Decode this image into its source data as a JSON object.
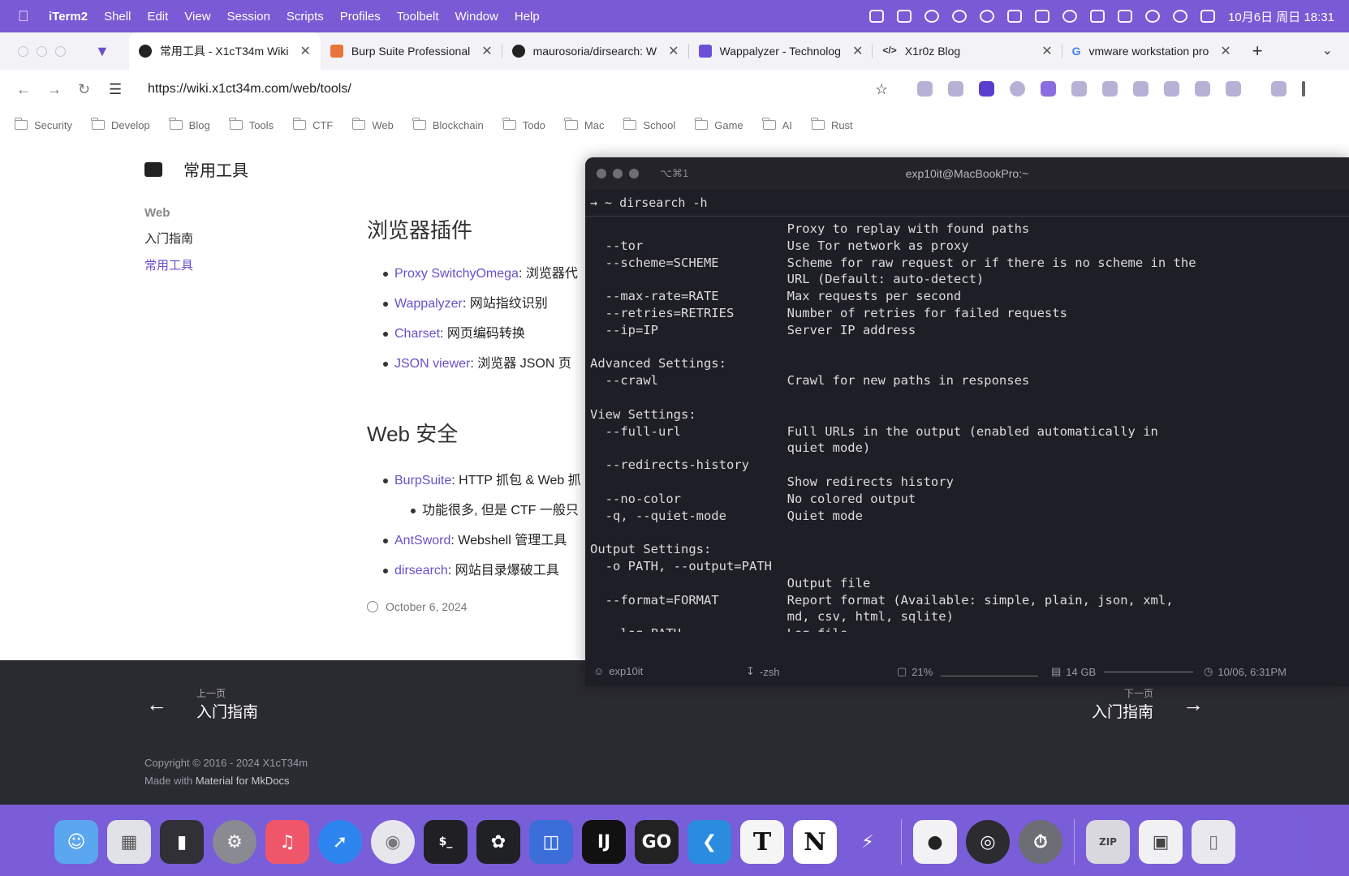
{
  "menubar": {
    "app": "iTerm2",
    "items": [
      "Shell",
      "Edit",
      "View",
      "Session",
      "Scripts",
      "Profiles",
      "Toolbelt",
      "Window",
      "Help"
    ],
    "clock": "10月6日 周日 18:31",
    "status_icons": [
      "display-icon",
      "screen-icon",
      "record-icon",
      "moon-icon",
      "vpn-icon",
      "cat-icon",
      "fan-icon",
      "sync-icon",
      "monitor-icon",
      "input-method-icon",
      "speaker-icon",
      "wifi-icon",
      "control-center-icon"
    ]
  },
  "browser": {
    "tabs": [
      {
        "title": "常用工具 - X1cT34m Wiki",
        "favicon": "#222222"
      },
      {
        "title": "Burp Suite Professional",
        "favicon": "#e8743b"
      },
      {
        "title": "maurosoria/dirsearch: W",
        "favicon": "#222222"
      },
      {
        "title": "Wappalyzer - Technolog",
        "favicon": "#6c4fd8"
      },
      {
        "title": "X1r0z Blog",
        "favicon": "#333333"
      },
      {
        "title": "vmware workstation pro",
        "favicon": "#4285f4"
      }
    ],
    "url": "https://wiki.x1ct34m.com/web/tools/",
    "bookmarks": [
      "Security",
      "Develop",
      "Blog",
      "Tools",
      "CTF",
      "Web",
      "Blockchain",
      "Todo",
      "Mac",
      "School",
      "Game",
      "AI",
      "Rust"
    ]
  },
  "page": {
    "site_title": "常用工具",
    "nav": {
      "section": "Web",
      "items": [
        "入门指南",
        "常用工具"
      ]
    },
    "sections": [
      {
        "heading": "浏览器插件",
        "items": [
          {
            "link": "Proxy SwitchyOmega",
            "text": ": 浏览器代"
          },
          {
            "link": "Wappalyzer",
            "text": ": 网站指纹识别"
          },
          {
            "link": "Charset",
            "text": ": 网页编码转换"
          },
          {
            "link": "JSON viewer",
            "text": ": 浏览器 JSON 页"
          }
        ]
      },
      {
        "heading": "Web 安全",
        "items": [
          {
            "link": "BurpSuite",
            "text": ": HTTP 抓包 & Web 抓"
          },
          {
            "sub": "功能很多, 但是 CTF 一般只"
          },
          {
            "link": "AntSword",
            "text": ": Webshell 管理工具"
          },
          {
            "link": "dirsearch",
            "text": ": 网站目录爆破工具"
          }
        ]
      }
    ],
    "date": "October 6, 2024",
    "footer": {
      "prev_label": "上一页",
      "prev_title": "入门指南",
      "next_label": "下一页",
      "next_title": "入门指南",
      "copyright": "Copyright © 2016 - 2024 X1cT34m",
      "made_prefix": "Made with ",
      "made_link": "Material for MkDocs"
    }
  },
  "terminal": {
    "shortcut": "⌥⌘1",
    "title": "exp10it@MacBookPro:~",
    "command": "→ ~ dirsearch -h",
    "output": "                          Proxy to replay with found paths\n  --tor                   Use Tor network as proxy\n  --scheme=SCHEME         Scheme for raw request or if there is no scheme in the\n                          URL (Default: auto-detect)\n  --max-rate=RATE         Max requests per second\n  --retries=RETRIES       Number of retries for failed requests\n  --ip=IP                 Server IP address\n\nAdvanced Settings:\n  --crawl                 Crawl for new paths in responses\n\nView Settings:\n  --full-url              Full URLs in the output (enabled automatically in\n                          quiet mode)\n  --redirects-history\n                          Show redirects history\n  --no-color              No colored output\n  -q, --quiet-mode        Quiet mode\n\nOutput Settings:\n  -o PATH, --output=PATH\n                          Output file\n  --format=FORMAT         Report format (Available: simple, plain, json, xml,\n                          md, csv, html, sqlite)\n  --log=PATH              Log file\n→ ~ dirsearch -u xxx",
    "status": {
      "user": "exp10it",
      "shell": "-zsh",
      "cpu": "21%",
      "mem": "14 GB",
      "time": "10/06, 6:31PM"
    }
  },
  "dock": [
    {
      "name": "finder-icon",
      "color": "#5aa7f0"
    },
    {
      "name": "launchpad-icon",
      "color": "#e1e1e8"
    },
    {
      "name": "iphone-mirroring-icon",
      "color": "#303036"
    },
    {
      "name": "system-settings-icon",
      "color": "#8a8a92"
    },
    {
      "name": "music-icon",
      "color": "#f0566a"
    },
    {
      "name": "safari-icon",
      "color": "#2d86ef"
    },
    {
      "name": "chrome-icon",
      "color": "#e6e6ec"
    },
    {
      "name": "terminal-icon",
      "color": "#1f1f24"
    },
    {
      "name": "chatgpt-icon",
      "color": "#202124"
    },
    {
      "name": "virtual-machine-icon",
      "color": "#3b6ed8"
    },
    {
      "name": "intellij-icon",
      "color": "#111111"
    },
    {
      "name": "goland-icon",
      "color": "#222222"
    },
    {
      "name": "vscode-icon",
      "color": "#2a8cdf"
    },
    {
      "name": "typora-icon",
      "color": "#f5f5f5"
    },
    {
      "name": "notion-icon",
      "color": "#ffffff"
    },
    {
      "name": "shortcut-icon",
      "color": "#7a5dd8"
    },
    {
      "name": "qq-icon",
      "color": "#f2f2f5"
    },
    {
      "name": "obs-icon",
      "color": "#2b2b30"
    },
    {
      "name": "proxy-icon",
      "color": "#6d6d75"
    },
    {
      "name": "archive-icon",
      "color": "#d8d8de"
    },
    {
      "name": "preview-icon",
      "color": "#f1f1f4"
    },
    {
      "name": "trash-icon",
      "color": "#e8e8ee"
    }
  ],
  "dock_labels": {
    "goland": "GO",
    "intellij": "IJ",
    "typora": "T",
    "notion": "N",
    "archive": "ZIP"
  }
}
